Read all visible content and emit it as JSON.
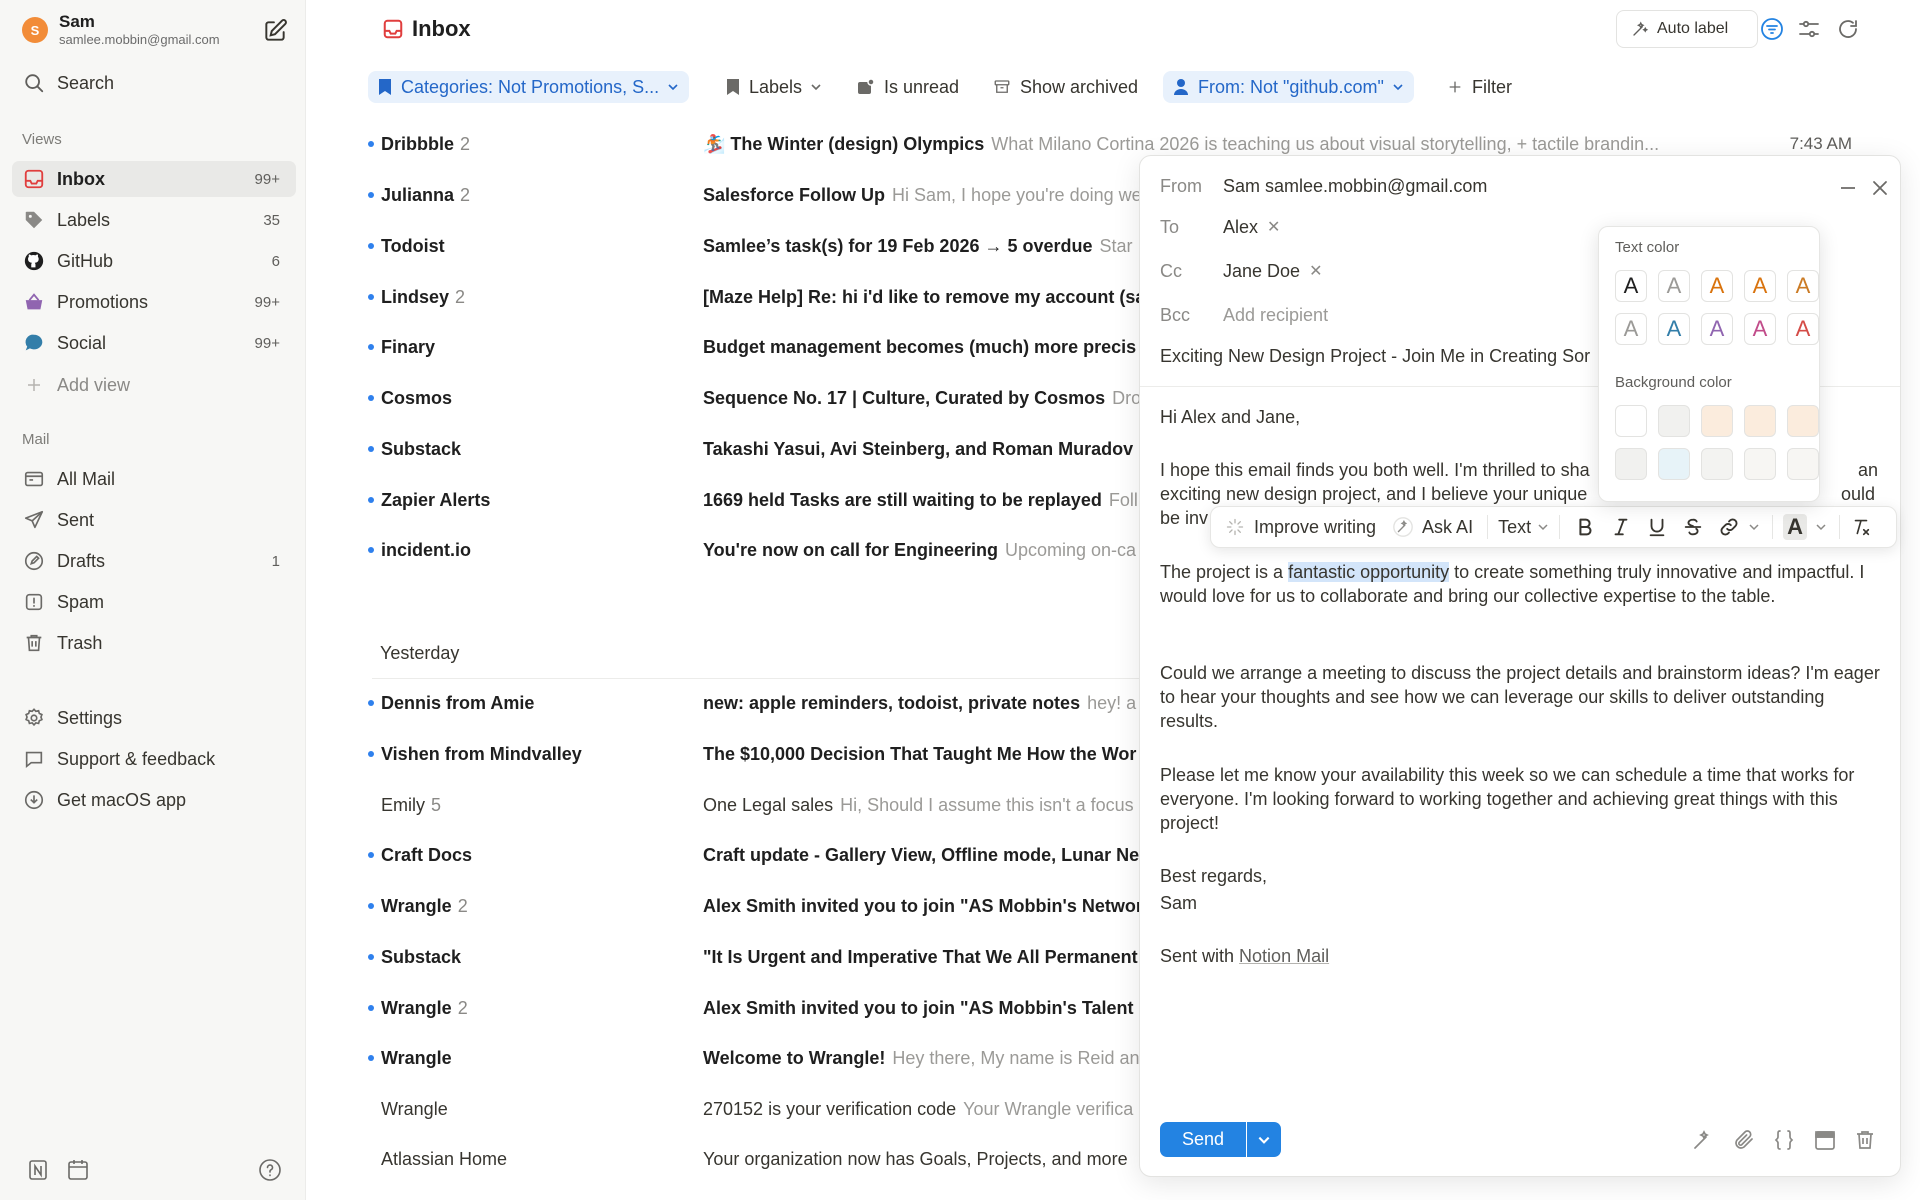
{
  "account": {
    "initial": "S",
    "name": "Sam",
    "email": "samlee.mobbin@gmail.com"
  },
  "search_label": "Search",
  "views": {
    "label": "Views",
    "items": [
      {
        "label": "Inbox",
        "count": "99+"
      },
      {
        "label": "Labels",
        "count": "35"
      },
      {
        "label": "GitHub",
        "count": "6"
      },
      {
        "label": "Promotions",
        "count": "99+"
      },
      {
        "label": "Social",
        "count": "99+"
      }
    ],
    "add_view": "Add view"
  },
  "mail": {
    "label": "Mail",
    "items": [
      {
        "label": "All Mail",
        "count": ""
      },
      {
        "label": "Sent",
        "count": ""
      },
      {
        "label": "Drafts",
        "count": "1"
      },
      {
        "label": "Spam",
        "count": ""
      },
      {
        "label": "Trash",
        "count": ""
      }
    ]
  },
  "footer_links": [
    "Settings",
    "Support & feedback",
    "Get macOS app"
  ],
  "header": {
    "title": "Inbox",
    "auto_label": "Auto label"
  },
  "filters": [
    {
      "label": "Categories: Not Promotions, S..."
    },
    {
      "label": "Labels"
    },
    {
      "label": "Is unread"
    },
    {
      "label": "Show archived"
    },
    {
      "label": "From: Not \"github.com\""
    },
    {
      "label": "Filter"
    }
  ],
  "emails_today": [
    {
      "sender": "Dribbble",
      "count": "2",
      "subject": "🏂 The Winter (design) Olympics",
      "preview": "What Milano Cortina 2026 is teaching us about visual storytelling, + tactile brandin...",
      "time": "7:43 AM"
    },
    {
      "sender": "Julianna",
      "count": "2",
      "subject": "Salesforce Follow Up",
      "preview": "Hi Sam, I hope you're doing we"
    },
    {
      "sender": "Todoist",
      "count": "",
      "subject": "Samlee’s task(s) for 19 Feb 2026 → 5 overdue",
      "preview": "Star"
    },
    {
      "sender": "Lindsey",
      "count": "2",
      "subject": "[Maze Help] Re: hi i'd like to remove my account (sa",
      "preview": ""
    },
    {
      "sender": "Finary",
      "count": "",
      "subject": "Budget management becomes (much) more precis",
      "preview": ""
    },
    {
      "sender": "Cosmos",
      "count": "",
      "subject": "Sequence No. 17 | Culture, Curated by Cosmos",
      "preview": "Dro"
    },
    {
      "sender": "Substack",
      "count": "",
      "subject": "Takashi Yasui, Avi Steinberg, and Roman Muradov p",
      "preview": ""
    },
    {
      "sender": "Zapier Alerts",
      "count": "",
      "subject": "1669 held Tasks are still waiting to be replayed",
      "preview": "Foll"
    },
    {
      "sender": "incident.io",
      "count": "",
      "subject": "You're now on call for Engineering",
      "preview": "Upcoming on-ca"
    }
  ],
  "yesterday_label": "Yesterday",
  "emails_yesterday": [
    {
      "sender": "Dennis from Amie",
      "count": "",
      "subject": "new: apple reminders, todoist, private notes",
      "preview": "hey! a",
      "unread": true
    },
    {
      "sender": "Vishen from Mindvalley",
      "count": "",
      "subject": "The $10,000 Decision That Taught Me How the Wor",
      "preview": "",
      "unread": true
    },
    {
      "sender": "Emily",
      "count": "5",
      "subject": "One Legal sales",
      "preview": "Hi, Should I assume this isn't a focus",
      "unread": false
    },
    {
      "sender": "Craft Docs",
      "count": "",
      "subject": "Craft update - Gallery View, Offline mode, Lunar Ne",
      "preview": "",
      "unread": true
    },
    {
      "sender": "Wrangle",
      "count": "2",
      "subject": "Alex Smith invited you to join \"AS Mobbin's Networ",
      "preview": "",
      "unread": true
    },
    {
      "sender": "Substack",
      "count": "",
      "subject": "\"It Is Urgent and Imperative That We All Permanent",
      "preview": "",
      "unread": true
    },
    {
      "sender": "Wrangle",
      "count": "2",
      "subject": "Alex Smith invited you to join \"AS Mobbin's Talent R",
      "preview": "",
      "unread": true
    },
    {
      "sender": "Wrangle",
      "count": "",
      "subject": "Welcome to Wrangle!",
      "preview": "Hey there, My name is Reid an",
      "unread": true
    },
    {
      "sender": "Wrangle",
      "count": "",
      "subject": "270152 is your verification code",
      "preview": "Your Wrangle verifica",
      "unread": false
    },
    {
      "sender": "Atlassian Home",
      "count": "",
      "subject": "Your organization now has Goals, Projects, and more",
      "preview": "",
      "unread": false
    }
  ],
  "compose": {
    "from_label": "From",
    "from_value": "Sam samlee.mobbin@gmail.com",
    "to_label": "To",
    "to_value": "Alex",
    "cc_label": "Cc",
    "cc_value": "Jane Doe",
    "bcc_label": "Bcc",
    "bcc_placeholder": "Add recipient",
    "subject": "Exciting New Design Project - Join Me in Creating Sor",
    "greeting": "Hi Alex and Jane,",
    "p1_line1": "I hope this email finds you both well. I'm thrilled to sha",
    "p1_line1_end": "an",
    "p1_line2": "exciting new design project, and I believe your unique",
    "p1_line2_end": "ould",
    "p1_line3": "be inv",
    "p2_before": "The project is a ",
    "p2_highlight": "fantastic opportunity",
    "p2_after": " to create something truly innovative and impactful. I would love for us to collaborate and bring our collective expertise to the table.",
    "p3": "Could we arrange a meeting to discuss the project details and brainstorm ideas? I'm eager to hear your thoughts and see how we can leverage our skills to deliver outstanding results.",
    "p4": "Please let me know your availability this week so we can schedule a time that works for everyone. I'm looking forward to working together and achieving great things with this project!",
    "signoff": "Best regards,",
    "signname": "Sam",
    "sent_with": "Sent with ",
    "sent_with_link": "Notion Mail",
    "send_label": "Send"
  },
  "toolbar": {
    "improve": "Improve writing",
    "ask_ai": "Ask AI",
    "text": "Text",
    "letter": "A"
  },
  "color_popover": {
    "text_color_label": "Text color",
    "background_color_label": "Background color",
    "letter": "A",
    "text_colors": [
      "#1f1f1f",
      "#9b9a97",
      "#d9730d",
      "#d9730d",
      "#cb7b25",
      "#9b9a97",
      "#337ea9",
      "#9065b0",
      "#c14c8a",
      "#d44c47"
    ],
    "bg_colors": [
      "#ffffff",
      "#f1f1ef",
      "#fbecdd",
      "#fbecdd",
      "#fbecdd",
      "#f1f1ef",
      "#e7f3f8",
      "#f3f3f1",
      "#f7f6f3",
      "#f7f6f3"
    ]
  },
  "colors": {
    "accent": "#2383e2",
    "unread_dot": "#2f80ed",
    "filter_blue": "#2467c8",
    "inbox_icon": "#e03e3e"
  }
}
